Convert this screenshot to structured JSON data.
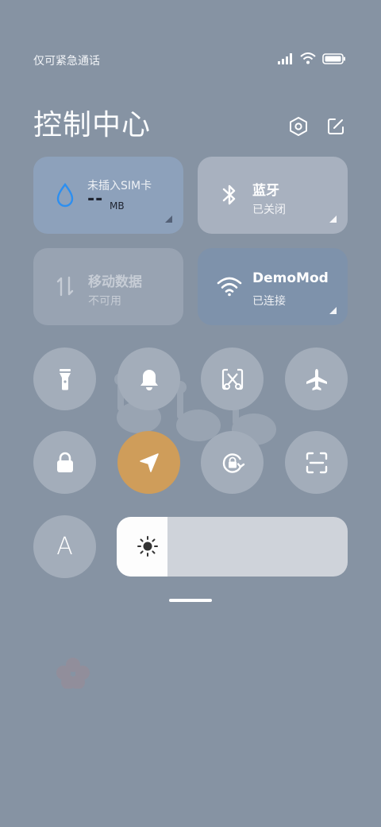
{
  "status_bar": {
    "carrier_text": "仅可紧急通话",
    "icons": [
      "signal-icon",
      "wifi-icon",
      "battery-icon"
    ]
  },
  "header": {
    "title": "控制中心",
    "settings_icon": "settings-icon",
    "edit_icon": "edit-icon"
  },
  "tiles": {
    "data_usage": {
      "title": "未插入SIM卡",
      "value": "--",
      "unit": "MB",
      "icon": "water-drop-icon"
    },
    "bluetooth": {
      "title": "蓝牙",
      "status": "已关闭",
      "icon": "bluetooth-icon"
    },
    "mobile_data": {
      "title": "移动数据",
      "status": "不可用",
      "icon": "mobile-data-icon"
    },
    "wifi": {
      "title": "DemoMod",
      "status": "已连接",
      "icon": "wifi-icon"
    }
  },
  "toggles": [
    {
      "name": "flashlight",
      "icon": "flashlight-icon",
      "active": false
    },
    {
      "name": "bell",
      "icon": "bell-icon",
      "active": false
    },
    {
      "name": "screenshot",
      "icon": "screenshot-icon",
      "active": false
    },
    {
      "name": "airplane",
      "icon": "airplane-icon",
      "active": false
    },
    {
      "name": "lock",
      "icon": "lock-icon",
      "active": false
    },
    {
      "name": "location",
      "icon": "location-icon",
      "active": true
    },
    {
      "name": "rotation-lock",
      "icon": "rotation-lock-icon",
      "active": false
    },
    {
      "name": "scanner",
      "icon": "scan-icon",
      "active": false
    }
  ],
  "font_button": {
    "label": "A"
  },
  "brightness": {
    "level": 0.22,
    "icon": "sun-icon"
  },
  "colors": {
    "background": "#8693a3",
    "circle": "#a3adba",
    "active_accent": "#cf9d5a",
    "data_tile": "#8da1bb",
    "wifi_tile": "#7e92ab"
  }
}
